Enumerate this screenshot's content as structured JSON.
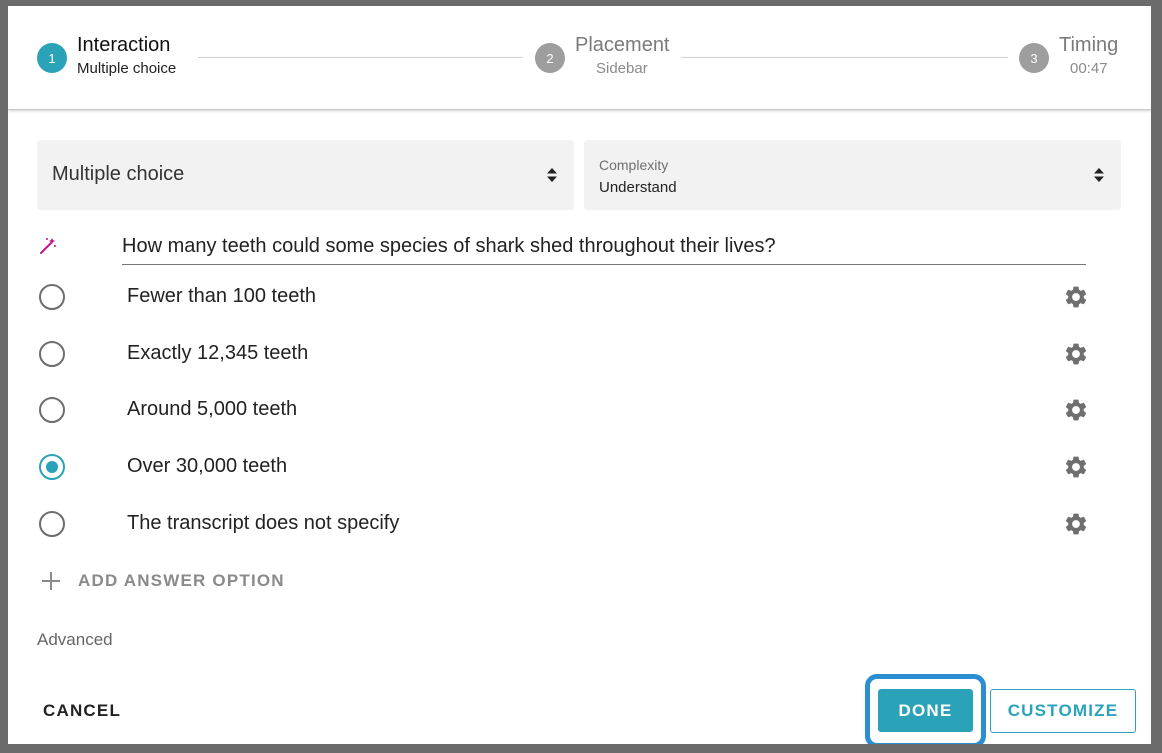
{
  "stepper": {
    "steps": [
      {
        "number": "1",
        "title": "Interaction",
        "subtitle": "Multiple choice",
        "state": "active"
      },
      {
        "number": "2",
        "title": "Placement",
        "subtitle": "Sidebar",
        "state": "inactive"
      },
      {
        "number": "3",
        "title": "Timing",
        "subtitle": "00:47",
        "state": "inactive"
      }
    ]
  },
  "type_select": {
    "value": "Multiple choice"
  },
  "complexity_select": {
    "label": "Complexity",
    "value": "Understand"
  },
  "question": {
    "text": "How many teeth could some species of shark shed throughout their lives?"
  },
  "options": [
    {
      "label": "Fewer than 100 teeth",
      "selected": false
    },
    {
      "label": "Exactly 12,345 teeth",
      "selected": false
    },
    {
      "label": "Around 5,000 teeth",
      "selected": false
    },
    {
      "label": "Over 30,000 teeth",
      "selected": true
    },
    {
      "label": "The transcript does not specify",
      "selected": false
    }
  ],
  "add_option_label": "ADD ANSWER OPTION",
  "advanced_label": "Advanced",
  "footer": {
    "cancel_label": "CANCEL",
    "done_label": "DONE",
    "customize_label": "CUSTOMIZE"
  },
  "colors": {
    "accent": "#2aa3b8",
    "focus_ring": "#2a8ed0",
    "inactive_step": "#9e9e9e",
    "wand": "#c2188a"
  },
  "icons": {
    "wand": "magic-wand-icon",
    "gear": "gear-icon",
    "plus": "plus-icon",
    "sort": "sort-arrows-icon"
  }
}
